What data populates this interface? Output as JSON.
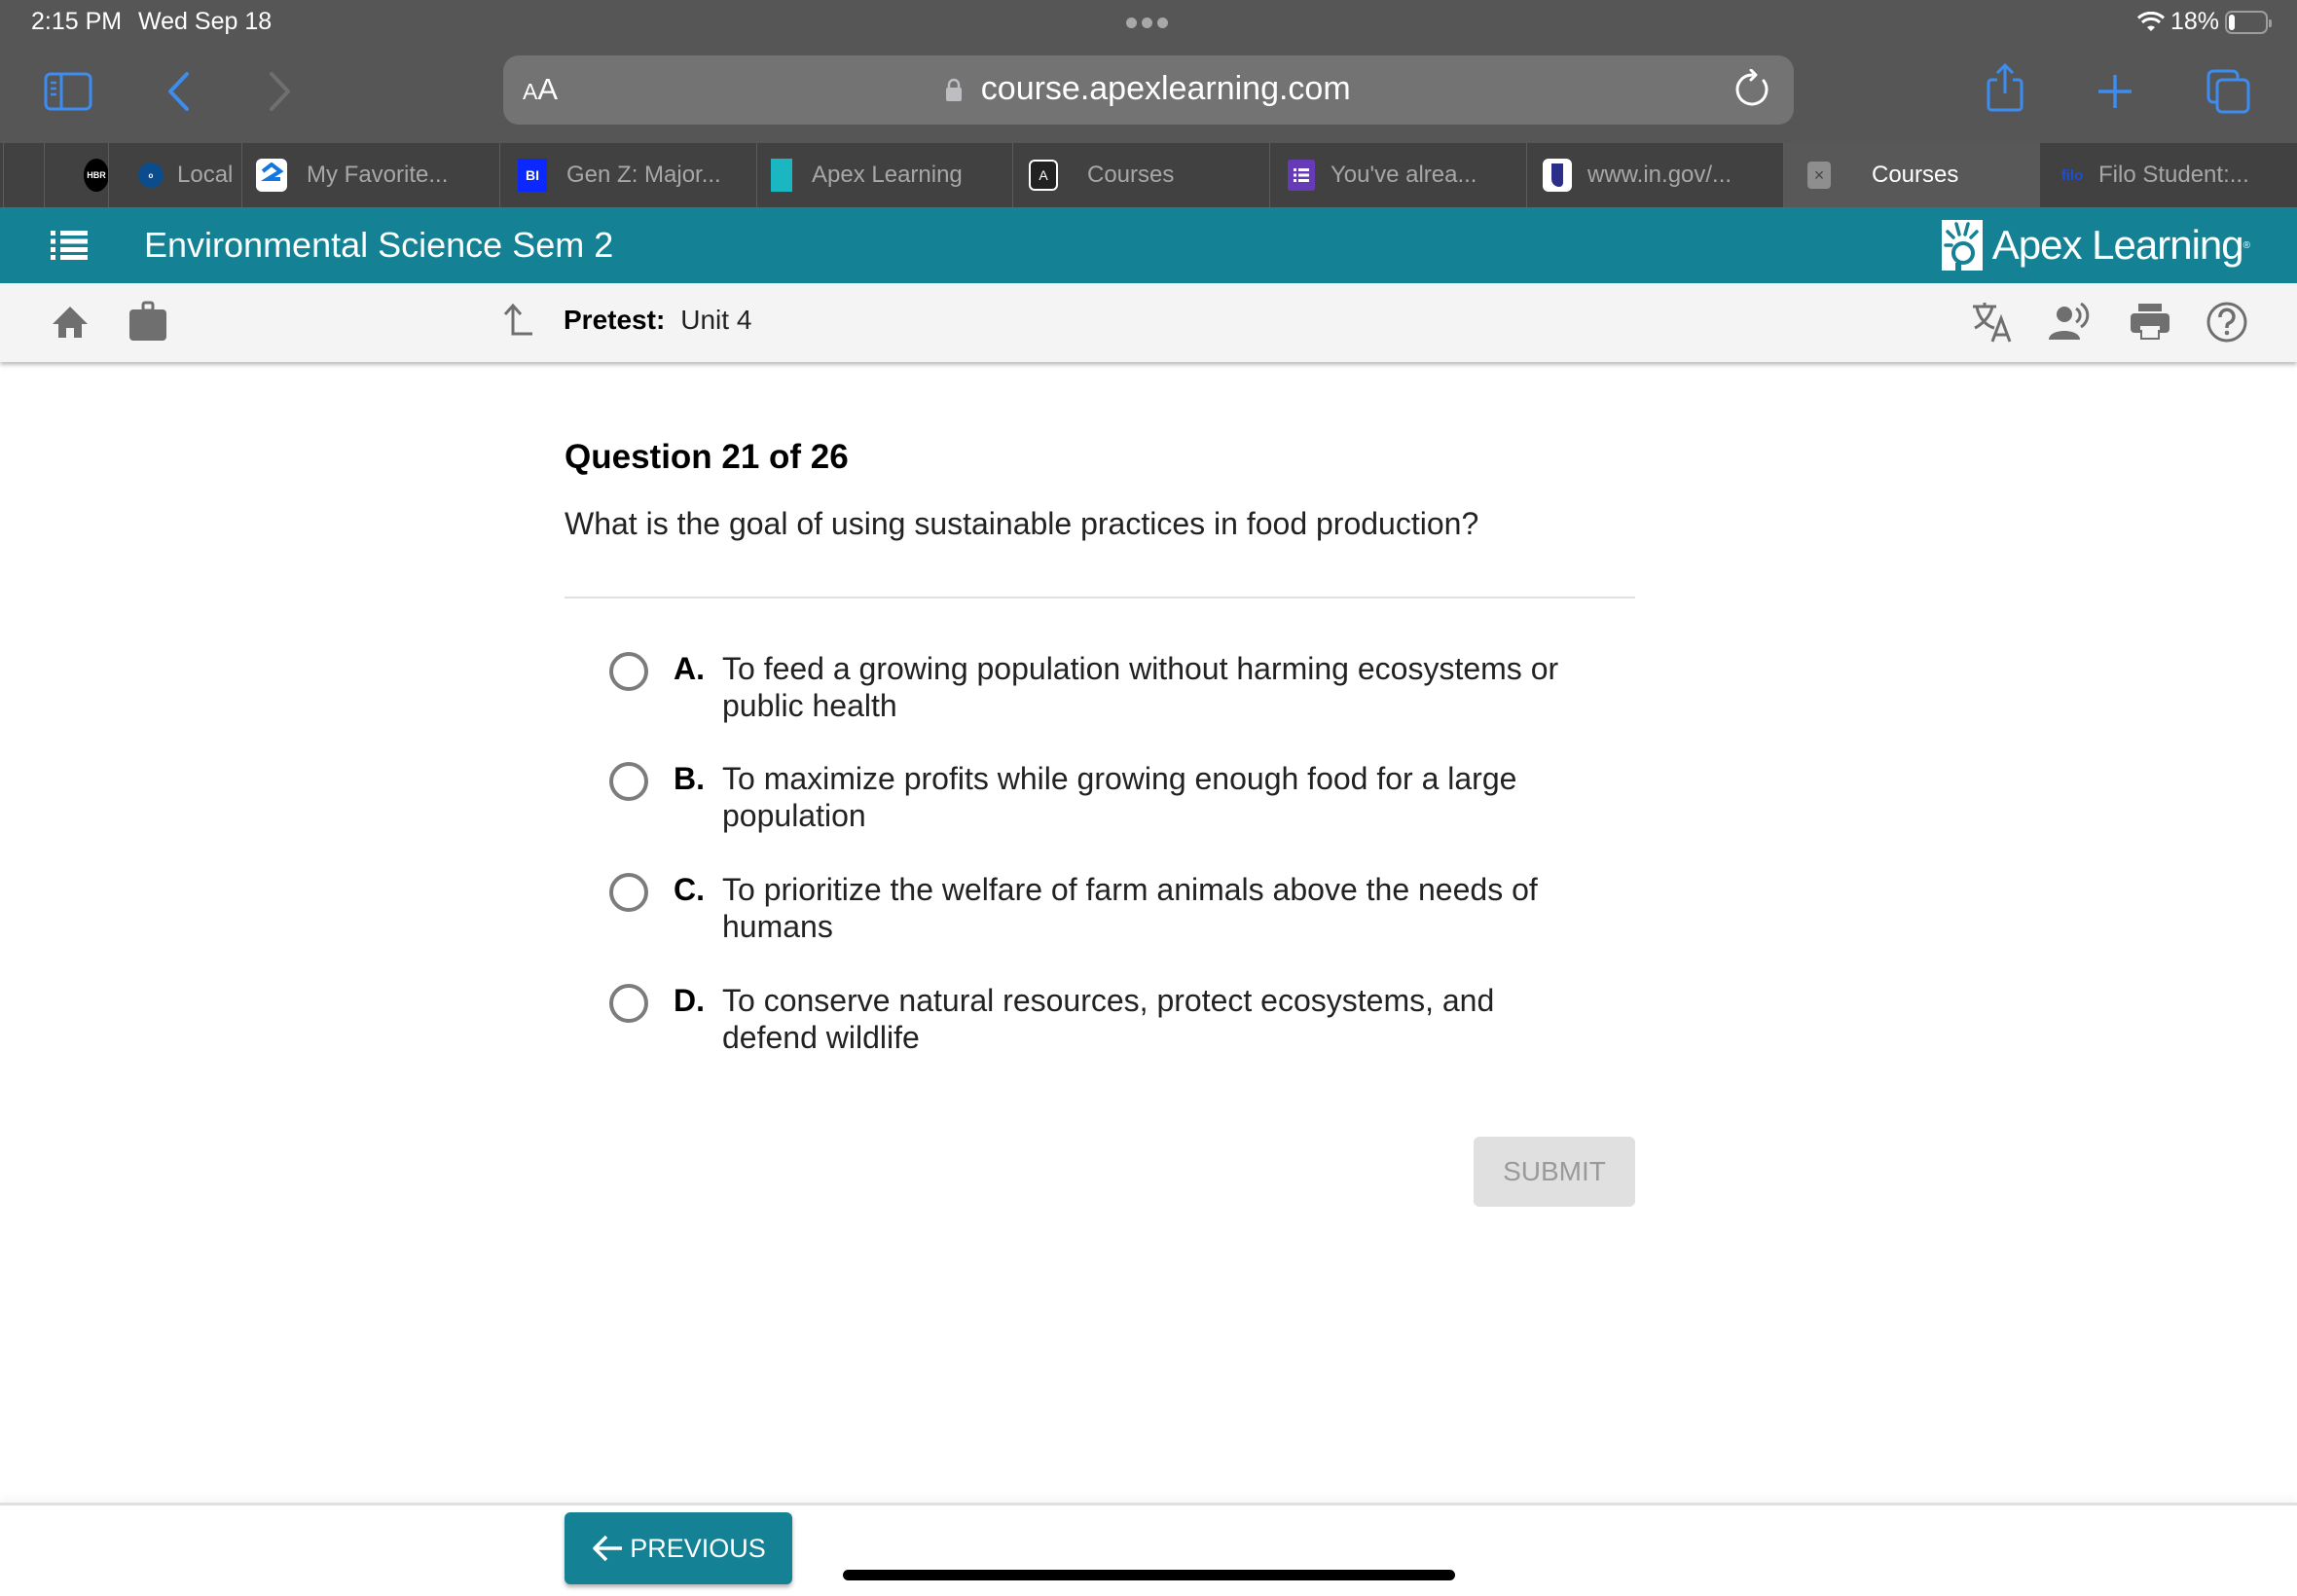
{
  "status_bar": {
    "time": "2:15 PM",
    "date": "Wed Sep 18",
    "battery": "18%",
    "battery_level": 0.18
  },
  "browser": {
    "text_size_label_small": "A",
    "text_size_label_large": "A",
    "url": "course.apexlearning.com",
    "icons": [
      "sidebar-icon",
      "back-icon",
      "forward-icon",
      "lock-icon",
      "reload-icon",
      "share-icon",
      "new-tab-icon",
      "tabs-icon"
    ],
    "tabs": [
      {
        "label": "",
        "favicon": ""
      },
      {
        "label": "",
        "favicon": "HBR"
      },
      {
        "label": "Local",
        "favicon": "onet"
      },
      {
        "label": "My Favorite...",
        "favicon": "zillow"
      },
      {
        "label": "Gen Z: Major...",
        "favicon": "BI"
      },
      {
        "label": "Apex Learning",
        "favicon": "apex"
      },
      {
        "label": "Courses",
        "favicon": "A"
      },
      {
        "label": "You've alrea...",
        "favicon": "forms"
      },
      {
        "label": "www.in.gov/...",
        "favicon": "indiana"
      },
      {
        "label": "Courses",
        "favicon": "close",
        "active": true
      },
      {
        "label": "Filo Student:...",
        "favicon": "filo"
      }
    ]
  },
  "app_header": {
    "course_title": "Environmental Science Sem 2",
    "brand": "Apex Learning",
    "brand_mark": "®"
  },
  "toolbar": {
    "breadcrumb_label": "Pretest:",
    "breadcrumb_value": "Unit 4",
    "icons": [
      "home-icon",
      "briefcase-icon",
      "up-arrow-icon",
      "translate-icon",
      "read-aloud-icon",
      "print-icon",
      "help-icon"
    ]
  },
  "question": {
    "number_label": "Question 21 of 26",
    "current": 21,
    "total": 26,
    "prompt": "What is the goal of using sustainable practices in food production?",
    "options": [
      {
        "letter": "A.",
        "text": "To feed a growing population without harming ecosystems or public health",
        "selected": false
      },
      {
        "letter": "B.",
        "text": "To maximize profits while growing enough food for a large population",
        "selected": false
      },
      {
        "letter": "C.",
        "text": "To prioritize the welfare of farm animals above the needs of humans",
        "selected": false
      },
      {
        "letter": "D.",
        "text": "To conserve natural resources, protect ecosystems, and defend wildlife",
        "selected": false
      }
    ],
    "submit_label": "SUBMIT",
    "submit_enabled": false
  },
  "footer": {
    "previous_label": "PREVIOUS"
  },
  "colors": {
    "brand_teal": "#148294",
    "browser_chrome": "#565656",
    "tab_strip": "#414141",
    "active_tab": "#585858",
    "ios_blue": "#3d8cf0",
    "toolbar_bg": "#f4f4f4",
    "submit_disabled_bg": "#e0e0e0"
  }
}
